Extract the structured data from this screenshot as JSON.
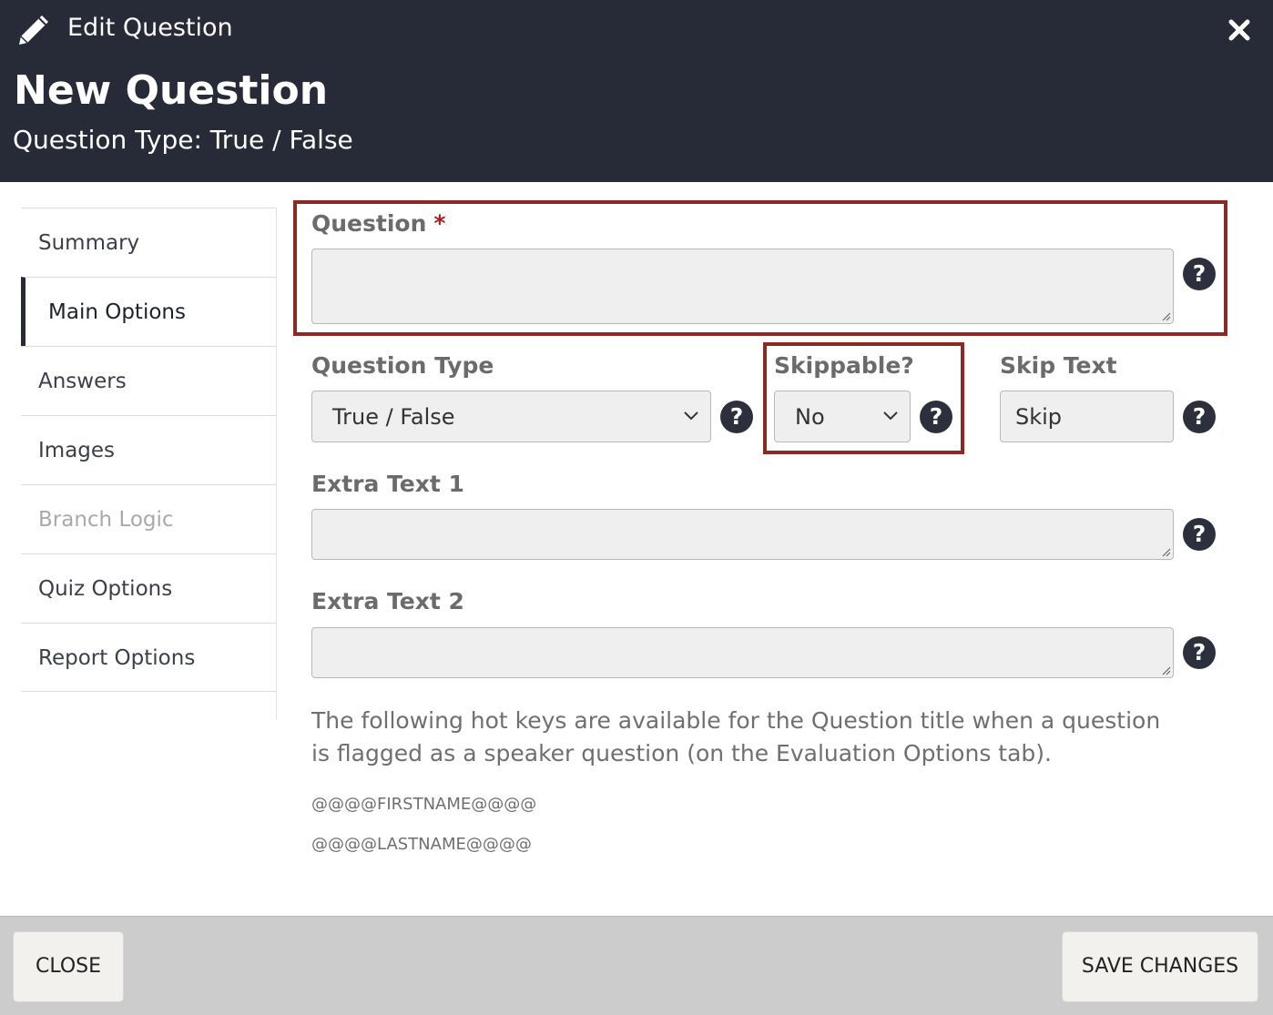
{
  "header": {
    "edit_title": "Edit Question",
    "title": "New Question",
    "subtitle": "Question Type: True / False"
  },
  "sidebar": {
    "items": [
      {
        "label": "Summary",
        "state": "normal"
      },
      {
        "label": "Main Options",
        "state": "active"
      },
      {
        "label": "Answers",
        "state": "normal"
      },
      {
        "label": "Images",
        "state": "normal"
      },
      {
        "label": "Branch Logic",
        "state": "disabled"
      },
      {
        "label": "Quiz Options",
        "state": "normal"
      },
      {
        "label": "Report Options",
        "state": "normal"
      }
    ]
  },
  "form": {
    "question_label": "Question",
    "required_mark": "*",
    "question_value": "",
    "question_type_label": "Question Type",
    "question_type_value": "True / False",
    "skippable_label": "Skippable?",
    "skippable_value": "No",
    "skip_text_label": "Skip Text",
    "skip_text_value": "Skip",
    "extra_text_1_label": "Extra Text 1",
    "extra_text_2_label": "Extra Text 2",
    "help_glyph": "?"
  },
  "info": {
    "text": "The following hot keys are available for the Question title when a question is flagged as a speaker question (on the Evaluation Options tab).",
    "hotkeys": [
      "@@@@FIRSTNAME@@@@",
      "@@@@LASTNAME@@@@"
    ]
  },
  "footer": {
    "close_label": "CLOSE",
    "save_label": "SAVE CHANGES"
  },
  "colors": {
    "header_bg": "#272b37",
    "highlight": "#8b2a22",
    "required": "#b31b1b",
    "footer_bg": "#cccccc"
  },
  "icons": [
    "pencil-icon",
    "close-icon",
    "help-icon",
    "chevron-down-icon"
  ]
}
